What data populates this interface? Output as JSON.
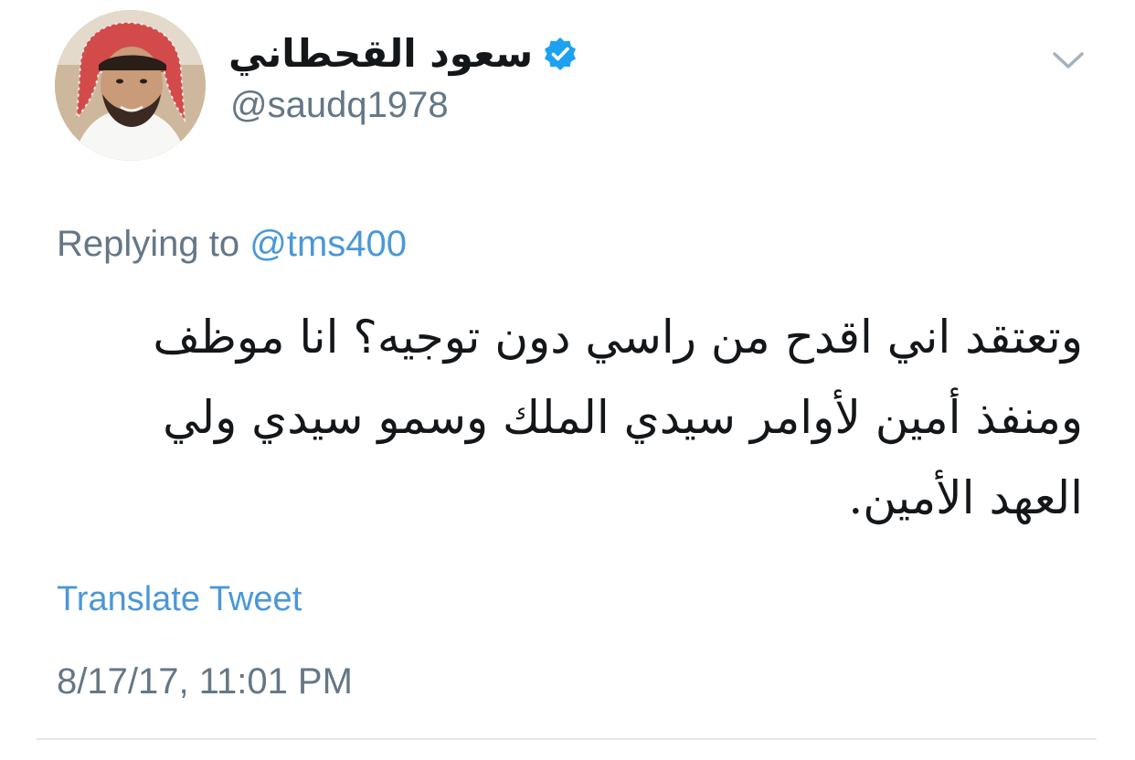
{
  "author": {
    "display_name": "سعود القحطاني",
    "handle": "@saudq1978",
    "verified": true
  },
  "reply": {
    "prefix": "Replying to",
    "mention": "@tms400"
  },
  "tweet": {
    "lines": [
      "وتعتقد اني اقدح من راسي دون توجيه؟ انا موظف",
      "ومنفذ أمين لأوامر سيدي الملك وسمو  سيدي ولي",
      "العهد الأمين."
    ]
  },
  "actions": {
    "translate_label": "Translate Tweet"
  },
  "meta": {
    "timestamp": "8/17/17, 11:01 PM"
  },
  "colors": {
    "link": "#4a98d8",
    "muted": "#657786",
    "text": "#14171a",
    "verified": "#1da1f2",
    "divider": "#e1e8ed"
  }
}
